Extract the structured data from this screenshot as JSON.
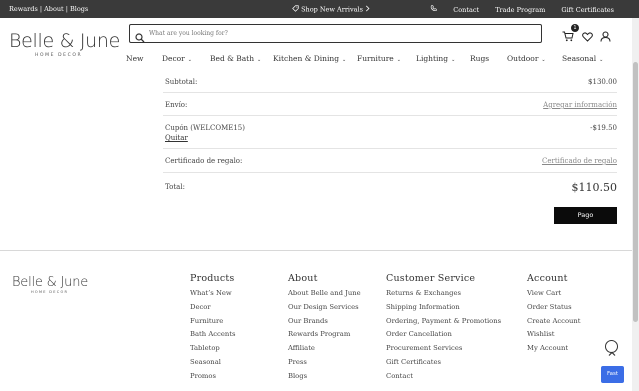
{
  "topbar": {
    "links": "Rewards | About | Blogs",
    "promo": "Shop New Arrivals",
    "contact": "Contact",
    "trade": "Trade Program",
    "gift": "Gift Certificates"
  },
  "brand": {
    "name": "Belle & June",
    "tagline": "HOME DECOR"
  },
  "search": {
    "placeholder": "What are you looking for?",
    "value": ""
  },
  "cart": {
    "count": "1"
  },
  "nav": [
    "New",
    "Decor",
    "Bed & Bath",
    "Kitchen & Dining",
    "Furniture",
    "Lighting",
    "Rugs",
    "Outdoor",
    "Seasonal"
  ],
  "summary": {
    "subtotal_label": "Subtotal:",
    "subtotal_value": "$130.00",
    "shipping_label": "Envío:",
    "shipping_link": "Agregar información",
    "coupon_label": "Cupón (WELCOME15)",
    "coupon_remove": "Quitar",
    "coupon_value": "-$19.50",
    "gift_label": "Certificado de regalo:",
    "gift_link": "Certificado de regalo",
    "total_label": "Total:",
    "total_value": "$110.50",
    "pay_button": "Pago"
  },
  "footer": {
    "products": {
      "title": "Products",
      "items": [
        "What’s New",
        "Decor",
        "Furniture",
        "Bath Accents",
        "Tabletop",
        "Seasonal",
        "Promos"
      ]
    },
    "about": {
      "title": "About",
      "items": [
        "About Belle and June",
        "Our Design Services",
        "Our Brands",
        "Rewards Program",
        "Affiliate",
        "Press",
        "Blogs"
      ]
    },
    "service": {
      "title": "Customer Service",
      "items": [
        "Returns & Exchanges",
        "Shipping Information",
        "Ordering, Payment & Promotions",
        "Order Cancellation",
        "Procurement Services",
        "Gift Certificates",
        "Contact"
      ]
    },
    "account": {
      "title": "Account",
      "items": [
        "View Cart",
        "Order Status",
        "Create Account",
        "Wishlist",
        "My Account"
      ]
    }
  },
  "fast_button": "Fast"
}
